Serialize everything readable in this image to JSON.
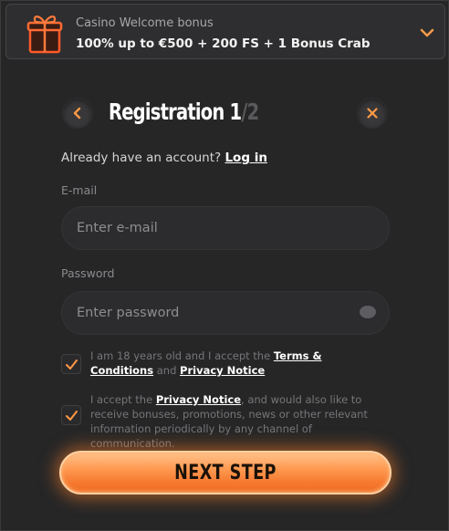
{
  "bonus": {
    "subtitle": "Casino Welcome bonus",
    "title": "100% up to €500 + 200 FS + 1 Bonus Crab"
  },
  "header": {
    "title": "Registration 1",
    "step_total": "/2"
  },
  "login_prompt": {
    "text": "Already have an account? ",
    "link": "Log in"
  },
  "form": {
    "email_label": "E-mail",
    "email_placeholder": "Enter e-mail",
    "password_label": "Password",
    "password_placeholder": "Enter password"
  },
  "consents": {
    "age": {
      "prefix": "I am 18 years old and I accept the ",
      "terms_link": "Terms & Conditions",
      "middle": " and ",
      "privacy_link": "Privacy Notice"
    },
    "marketing": {
      "prefix": "I accept the ",
      "privacy_link": "Privacy Notice",
      "suffix": ", and would also like to receive bonuses, promotions, news or other relevant information periodically by any channel of communication."
    }
  },
  "next_button": {
    "label": "NEXT STEP"
  },
  "colors": {
    "accent": "#f6792f",
    "background": "#262627",
    "input_bg": "#2c2c2e"
  },
  "icons": {
    "gift": "gift-icon",
    "chevron": "chevron-down-icon",
    "back": "chevron-left-icon",
    "close": "close-icon",
    "eye": "eye-icon",
    "check": "checkmark-icon"
  }
}
